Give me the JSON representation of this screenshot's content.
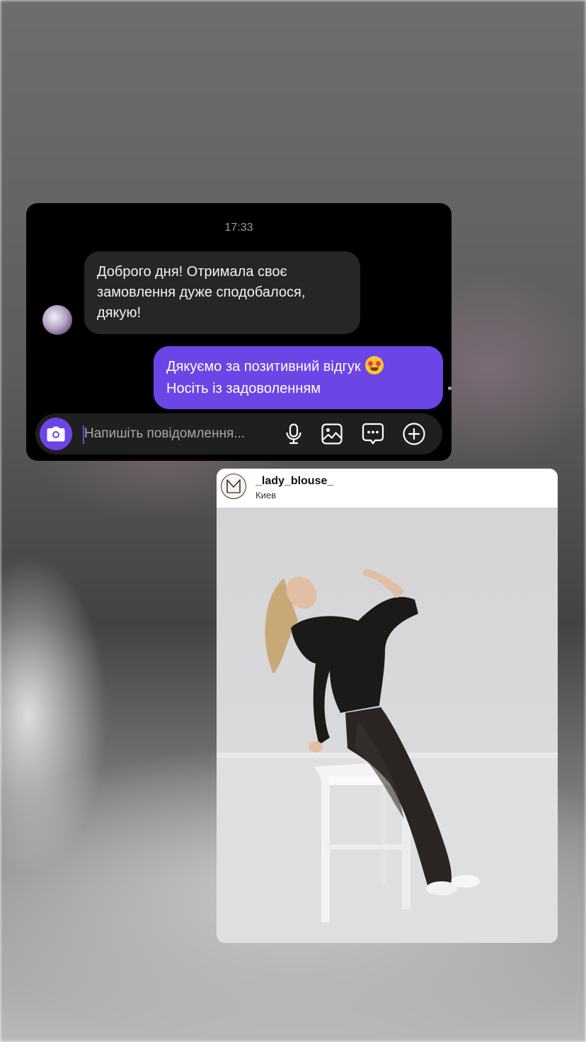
{
  "chat": {
    "timestamp": "17:33",
    "incoming_message": "Доброго дня! Отримала своє замовлення дуже сподобалося, дякую!",
    "outgoing_line1": "Дякуємо за позитивний відгук",
    "outgoing_emoji": "smiling-face-with-heart-eyes",
    "outgoing_line2": "Носіть із задоволенням",
    "composer_placeholder": "Напишіть повідомлення...",
    "accent_color": "#6c45e6",
    "icons": [
      "camera-icon",
      "microphone-icon",
      "gallery-icon",
      "sticker-icon",
      "plus-circle-icon"
    ]
  },
  "post": {
    "username": "_lady_blouse_",
    "location": "Киев",
    "avatar_icon": "brand-logo-m",
    "image_description_icon": "photo"
  }
}
